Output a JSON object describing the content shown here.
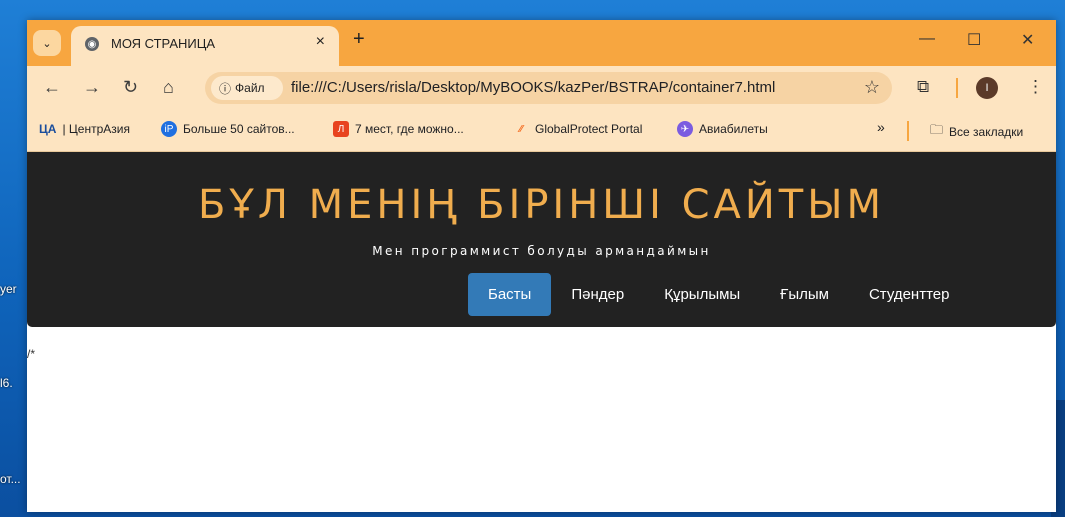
{
  "desktop": {
    "labels": [
      "yer",
      "l6.",
      "от..."
    ]
  },
  "browser": {
    "tab_title": "МОЯ СТРАНИЦА",
    "new_tab": "+",
    "close_tab": "×",
    "site_chip": "Файл",
    "url": "file:///C:/Users/risla/Desktop/MyBOOKS/kazPer/BSTRAP/container7.html",
    "profile_initial": "I",
    "bookmarks": [
      {
        "label": "| ЦентрАзия",
        "icon": "ЦА",
        "color": "#1a4d9c"
      },
      {
        "label": "Больше 50 сайтов...",
        "icon": "iP",
        "color": "#1f6fe0"
      },
      {
        "label": "7 мест, где можно...",
        "icon": "Л",
        "color": "#e8431f"
      },
      {
        "label": "GlobalProtect Portal",
        "icon": "⁄⁄",
        "color": "#f46a1f"
      },
      {
        "label": "Авиабилеты",
        "icon": "✈",
        "color": "#7b5ce0"
      }
    ],
    "bookmarks_more": "»",
    "all_bookmarks": "Все закладки"
  },
  "page": {
    "title": "БҰЛ МЕНІҢ БІРІНШІ САЙТЫМ",
    "subtitle": "Мен программист болуды армандаймын",
    "nav": [
      {
        "label": "Басты",
        "active": true
      },
      {
        "label": "Пәндер",
        "active": false
      },
      {
        "label": "Құрылымы",
        "active": false
      },
      {
        "label": "Ғылым",
        "active": false
      },
      {
        "label": "Студенттер",
        "active": false
      }
    ],
    "body_text": "/*"
  },
  "colors": {
    "titlebar": "#f7a640",
    "toolbar": "#fde4c1",
    "header": "#222222",
    "title_gold": "#f0ad4e",
    "nav_active": "#337ab7"
  }
}
